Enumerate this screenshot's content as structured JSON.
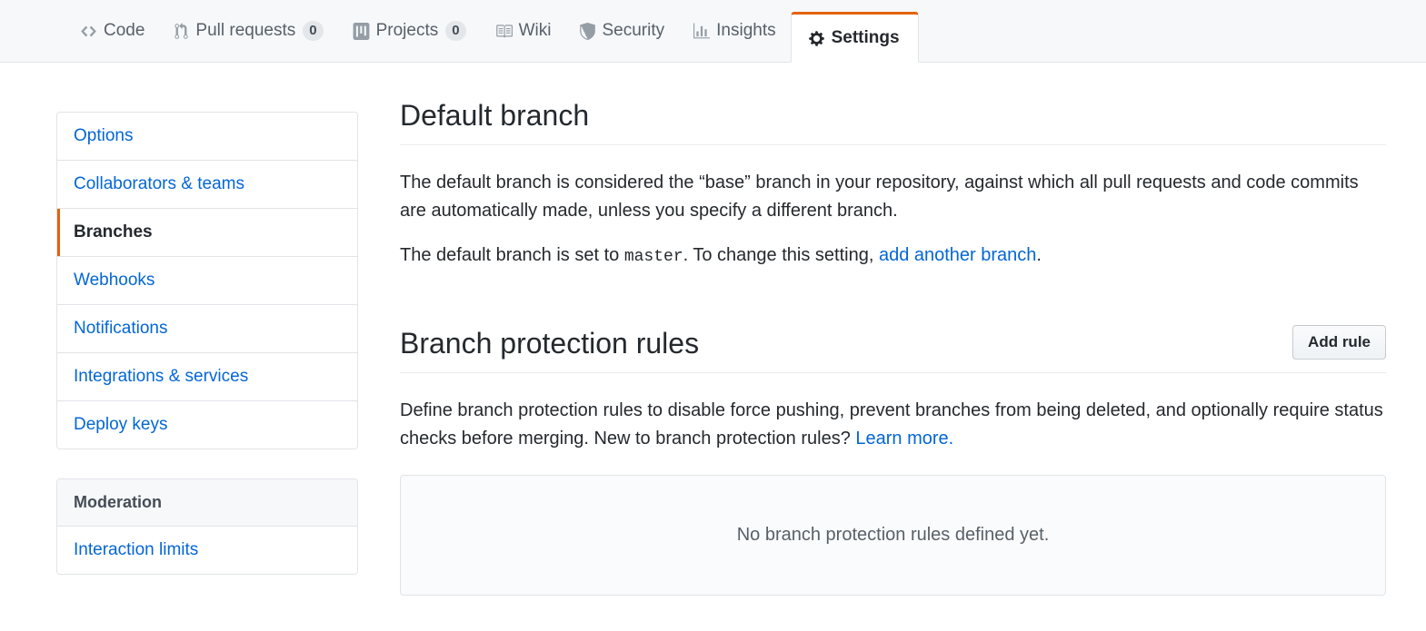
{
  "colors": {
    "accent_orange": "#e36209",
    "link_blue": "#0366d6",
    "nav_bg": "#f6f8fa",
    "border": "#e1e4e8",
    "text": "#24292e",
    "muted_text": "#586069"
  },
  "repo_nav": {
    "tabs": [
      {
        "label": "Code",
        "icon": "code-icon",
        "counter": null,
        "selected": false
      },
      {
        "label": "Pull requests",
        "icon": "git-pull-request-icon",
        "counter": "0",
        "selected": false
      },
      {
        "label": "Projects",
        "icon": "project-board-icon",
        "counter": "0",
        "selected": false
      },
      {
        "label": "Wiki",
        "icon": "book-icon",
        "counter": null,
        "selected": false
      },
      {
        "label": "Security",
        "icon": "shield-icon",
        "counter": null,
        "selected": false
      },
      {
        "label": "Insights",
        "icon": "graph-icon",
        "counter": null,
        "selected": false
      },
      {
        "label": "Settings",
        "icon": "gear-icon",
        "counter": null,
        "selected": true
      }
    ]
  },
  "sidebar": {
    "groups": [
      {
        "heading": null,
        "items": [
          {
            "label": "Options",
            "selected": false
          },
          {
            "label": "Collaborators & teams",
            "selected": false
          },
          {
            "label": "Branches",
            "selected": true
          },
          {
            "label": "Webhooks",
            "selected": false
          },
          {
            "label": "Notifications",
            "selected": false
          },
          {
            "label": "Integrations & services",
            "selected": false
          },
          {
            "label": "Deploy keys",
            "selected": false
          }
        ]
      },
      {
        "heading": "Moderation",
        "items": [
          {
            "label": "Interaction limits",
            "selected": false
          }
        ]
      }
    ]
  },
  "main": {
    "default_branch": {
      "title": "Default branch",
      "paragraph_1": "The default branch is considered the “base” branch in your repository, against which all pull requests and code commits are automatically made, unless you specify a different branch.",
      "set_prefix": "The default branch is set to ",
      "branch_name": "master",
      "set_middle": ". To change this setting, ",
      "link_label": "add another branch",
      "set_suffix": "."
    },
    "branch_protection": {
      "title": "Branch protection rules",
      "add_rule_label": "Add rule",
      "description_prefix": "Define branch protection rules to disable force pushing, prevent branches from being deleted, and optionally require status checks before merging. New to branch protection rules? ",
      "learn_more_label": "Learn more.",
      "empty_state": "No branch protection rules defined yet."
    }
  }
}
